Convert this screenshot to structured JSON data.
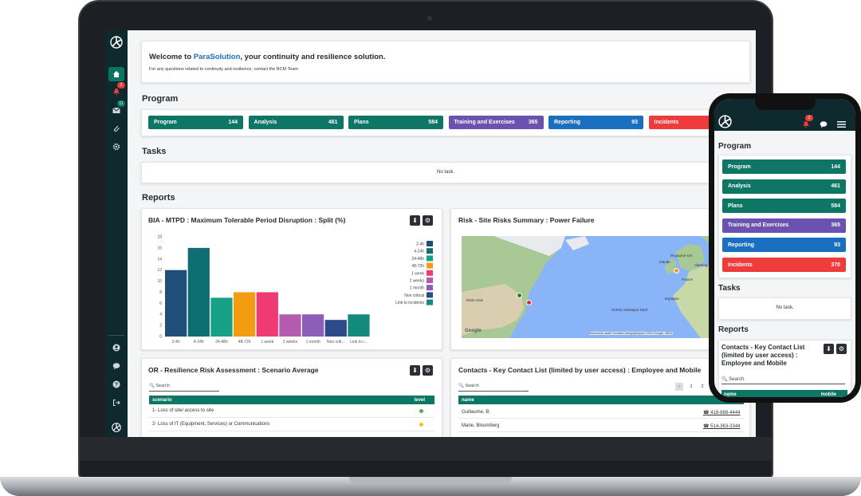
{
  "welcome": {
    "prefix": "Welcome to ",
    "brand": "ParaSolution",
    "suffix": ", your continuity and resilience solution.",
    "subtitle": "For any questions related to continuity and resilience, contact the BCM Team"
  },
  "sections": {
    "program": "Program",
    "tasks": "Tasks",
    "reports": "Reports"
  },
  "program": [
    {
      "label": "Program",
      "count": "144",
      "color": "#0e7665"
    },
    {
      "label": "Analysis",
      "count": "461",
      "color": "#0e7665"
    },
    {
      "label": "Plans",
      "count": "584",
      "color": "#0e7665"
    },
    {
      "label": "Training and Exercises",
      "count": "365",
      "color": "#6a52b0"
    },
    {
      "label": "Reporting",
      "count": "93",
      "color": "#1a6fc0"
    },
    {
      "label": "Incidents",
      "count": "370",
      "color": "#ee3b3b"
    }
  ],
  "tasks": {
    "empty": "No task."
  },
  "sidebar": {
    "notifications_badge": "2",
    "messages_badge": "11"
  },
  "reports": {
    "bia": {
      "title": "BIA - MTPD : Maximum Tolerable Period Disruption : Split (%)"
    },
    "risk": {
      "title": "Risk - Site Risks Summary : Power Failure",
      "map_labels": [
        "Irlande",
        "Royaume-Uni",
        "Allemagne",
        "France",
        "Espagne",
        "États-Unis",
        "Océan Atlantique Nord"
      ],
      "attribution": "Raccourcis clavier   Données cartographiques ©2024 Google, INEGI",
      "google": "Google"
    },
    "or": {
      "title": "OR - Resilience Risk Assessment : Scenario Average",
      "search": "Search",
      "columns": [
        "scenario",
        "level"
      ],
      "rows": [
        {
          "scenario": "1- Loss of site/ access to site",
          "level_color": "#4caf50"
        },
        {
          "scenario": "2- Loss of IT (Equipment, Services) or Communications",
          "level_color": "#f5c518"
        }
      ]
    },
    "contacts": {
      "title": "Contacts - Key Contact List (limited by user access) : Employee and Mobile",
      "search": "Search",
      "columns": [
        "name",
        "mobile"
      ],
      "pages": [
        "‹",
        "1",
        "2"
      ],
      "rows": [
        {
          "name": "Guillaume, B.",
          "mobile": "418-888-4444"
        },
        {
          "name": "Marie, Bloomberg",
          "mobile": "514-363-3344"
        }
      ]
    }
  },
  "chart_data": {
    "type": "bar",
    "title": "BIA - MTPD : Maximum Tolerable Period Disruption : Split (%)",
    "categories": [
      "2-4h",
      "4-24h",
      "24-48h",
      "48-72h",
      "1 week",
      "2 weeks",
      "1 month",
      "Non criti...",
      "Link to i..."
    ],
    "legend": [
      "2-4h",
      "4-24h",
      "24-48h",
      "48-72h",
      "1 week",
      "2 weeks",
      "1 month",
      "Non critical",
      "Link to incidents"
    ],
    "values": [
      12,
      16,
      7,
      8,
      8,
      4,
      4,
      3,
      4
    ],
    "colors": [
      "#1f4e79",
      "#0e6e72",
      "#16a085",
      "#f39c12",
      "#ee3b74",
      "#b45bb0",
      "#8e5db8",
      "#2d4a8a",
      "#138a7c"
    ],
    "yticks": [
      0,
      2,
      4,
      6,
      8,
      10,
      12,
      14,
      16,
      18
    ],
    "ylim": [
      0,
      18
    ],
    "legend_position": "right"
  },
  "mobile": {
    "notifications_badge": "2",
    "section_program": "Program",
    "section_tasks": "Tasks",
    "section_reports": "Reports",
    "tasks_empty": "No task.",
    "report_title": "Contacts - Key Contact List (limited by user access) : Employee and Mobile",
    "search": "Search",
    "columns": [
      "name",
      "mobile"
    ]
  }
}
